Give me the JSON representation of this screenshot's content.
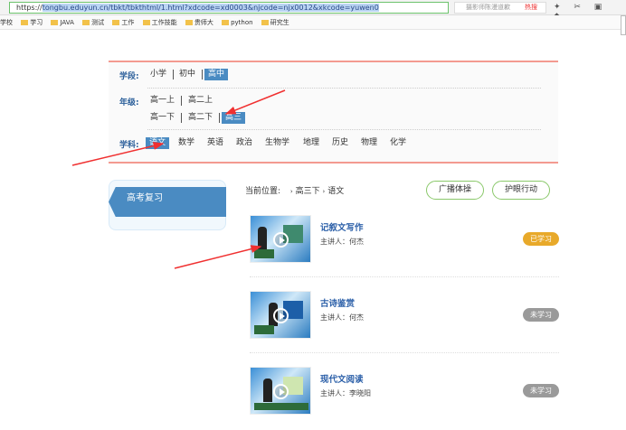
{
  "browser": {
    "url_prefix": "https://",
    "url": "tongbu.eduyun.cn/tbkt/tbkthtml/1.html?xdcode=xd0003&njcode=njx0012&xkcode=yuwen0",
    "search_placeholder": "摄影师陈漫道歉",
    "hot_label": "热搜",
    "bookmarks": [
      "学校",
      "学习",
      "JAVA",
      "测试",
      "工作",
      "工作技能",
      "贵师大",
      "python",
      "研究生"
    ]
  },
  "filter": {
    "stage_label": "学段:",
    "stages": [
      "小学",
      "初中",
      "高中"
    ],
    "stage_selected": "高中",
    "grade_label": "年级:",
    "grades_row1": [
      "高一上",
      "高二上"
    ],
    "grades_row2": [
      "高一下",
      "高二下",
      "高三"
    ],
    "grade_selected": "高三",
    "subject_label": "学科:",
    "subjects": [
      "语文",
      "数学",
      "英语",
      "政治",
      "生物学",
      "地理",
      "历史",
      "物理",
      "化学"
    ],
    "subject_selected": "语文"
  },
  "sidebar": {
    "title": "高考复习"
  },
  "breadcrumb": {
    "label": "当前位置:",
    "items": [
      "高三下",
      "语文"
    ]
  },
  "buttons": {
    "broadcast": "广播体操",
    "eye": "护眼行动"
  },
  "lessons": [
    {
      "title": "记叙文写作",
      "speaker": "主讲人：何杰",
      "status": "已学习",
      "status_color": "#e8a92a"
    },
    {
      "title": "古诗鉴赏",
      "speaker": "主讲人：何杰",
      "status": "未学习",
      "status_color": "#9a9a9a"
    },
    {
      "title": "现代文阅读",
      "speaker": "主讲人：李晓阳",
      "status": "未学习",
      "status_color": "#9a9a9a"
    }
  ],
  "colors": {
    "accent": "#4a8bc2",
    "panel_border": "#f39a90",
    "button_border": "#8ac86a",
    "annotation_arrow": "#f03030"
  }
}
